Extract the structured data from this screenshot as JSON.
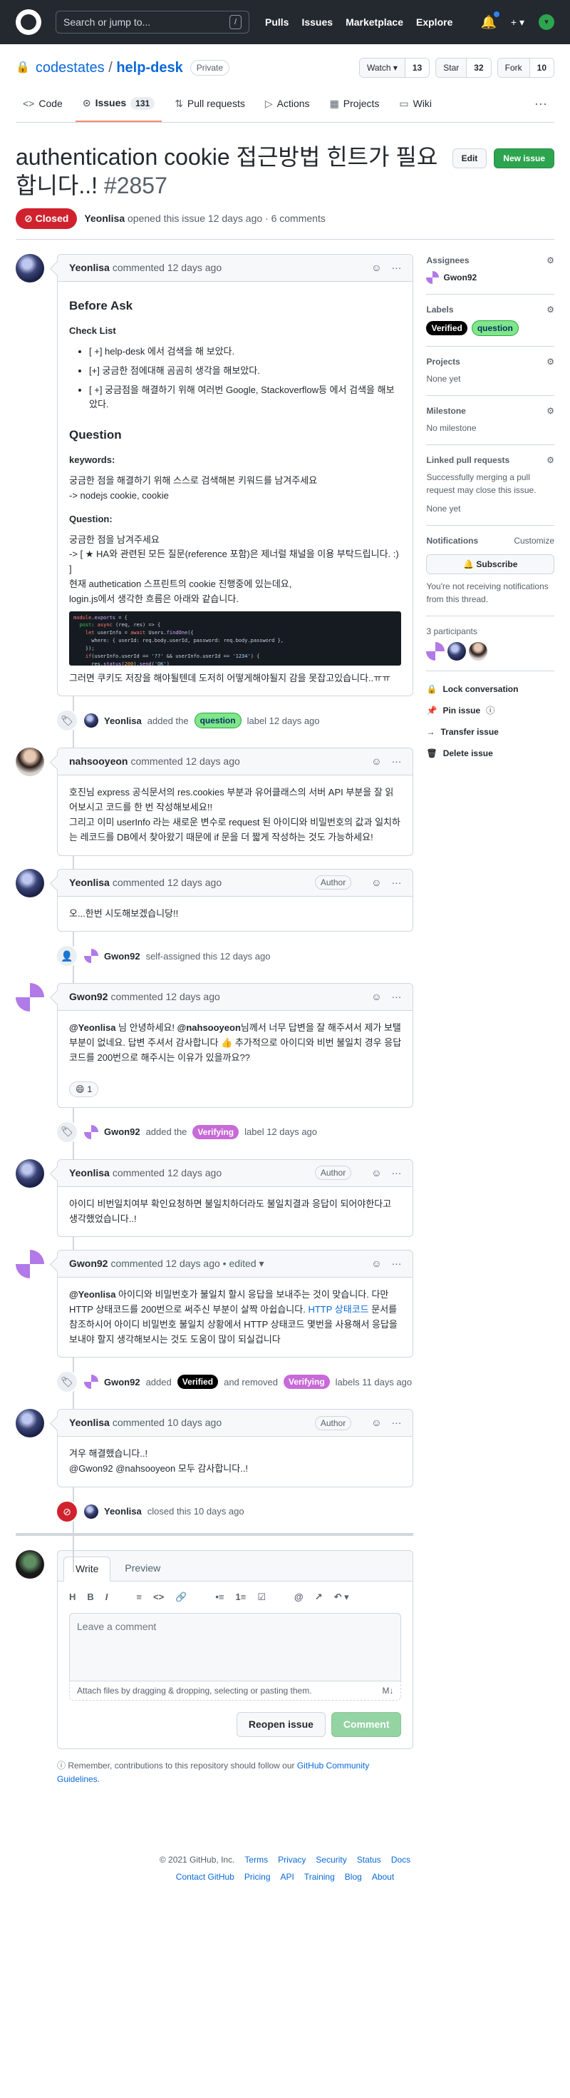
{
  "header": {
    "search_placeholder": "Search or jump to...",
    "slash_key": "/",
    "nav": [
      "Pulls",
      "Issues",
      "Marketplace",
      "Explore"
    ],
    "plus": "+ ▾"
  },
  "repo": {
    "owner": "codestates",
    "sep": " / ",
    "name": "help-desk",
    "visibility": "Private",
    "watch_label": "Watch ▾",
    "watch_count": "13",
    "star_label": "Star",
    "star_count": "32",
    "fork_label": "Fork",
    "fork_count": "10",
    "tabs": [
      {
        "label": "Code",
        "icon": "<>"
      },
      {
        "label": "Issues",
        "icon": "⊙",
        "count": "131"
      },
      {
        "label": "Pull requests",
        "icon": "⇅"
      },
      {
        "label": "Actions",
        "icon": "▷"
      },
      {
        "label": "Projects",
        "icon": "▦"
      },
      {
        "label": "Wiki",
        "icon": "▭"
      }
    ],
    "more": "···"
  },
  "issue": {
    "title": "authentication cookie 접근방법 힌트가 필요합니다..!",
    "number": "#2857",
    "edit_label": "Edit",
    "new_issue_label": "New issue",
    "state": "Closed",
    "author": "Yeonlisa",
    "meta": "opened this issue 12 days ago · 6 comments"
  },
  "comments": {
    "c1": {
      "author": "Yeonlisa",
      "time": "commented 12 days ago",
      "h_before": "Before Ask",
      "h_check": "Check List",
      "check": [
        "[ +] help-desk 에서 검색을 해 보았다.",
        "[+] 궁금한 점에대해 곰곰히 생각을 해보았다.",
        "[ +] 궁금점을 해결하기 위해 여러번 Google, Stackoverflow등 에서 검색을 해보았다."
      ],
      "h_question": "Question",
      "h_keywords": "keywords:",
      "kw1": "궁금한 점을 해결하기 위해 스스로 검색해본 키워드를 남겨주세요",
      "kw2": "-> nodejs cookie, cookie",
      "h_q": "Question:",
      "q1": "궁금한 점을 남겨주세요",
      "q2": "-> [ ★ HA와 관련된 모든 질문(reference 포함)은 제너럴 채널을 이용 부탁드립니다. :) ]",
      "q3": "현재 authetication 스프린트의 cookie 진행중에 있는데요,",
      "q4": "login.js에서 생각한 흐름은 아래와 같습니다.",
      "q5": "그러면 쿠키도 저장을 해야될텐데 도저히 어떻게해야될지 감을 못잡고있습니다..ㅠㅠ"
    },
    "ev1": {
      "who": "Yeonlisa",
      "a": "added the",
      "label": "question",
      "b": "label 12 days ago"
    },
    "c2": {
      "author": "nahsooyeon",
      "time": "commented 12 days ago",
      "p1": "호진님 express 공식문서의 res.cookies 부분과 유어클래스의 서버 API 부분을 잘 읽어보시고 코드를 한 번 작성해보세요!!",
      "p2": "그리고 이미 userInfo 라는 새로운 변수로 request 된 아이디와 비밀번호의 값과 일치하는 레코드를 DB에서 찾아왔기 때문에 if 문을 더 짧게 작성하는 것도 가능하세요!"
    },
    "c3": {
      "author": "Yeonlisa",
      "time": "commented 12 days ago",
      "badge": "Author",
      "p1": "오...한번 시도해보겠습니당!!"
    },
    "ev2": {
      "who": "Gwon92",
      "text": "self-assigned this 12 days ago"
    },
    "c4": {
      "author": "Gwon92",
      "time": "commented 12 days ago",
      "m1": "@Yeonlisa",
      "t1": " 님 안녕하세요! ",
      "m2": "@nahsooyeon",
      "t2": "님께서 너무 답변을 잘 해주셔서 제가 보탤 부분이 없네요. 답변 주셔서 감사합니다 👍 추가적으로 아이디와 비번 불일치 경우 응답코드를 200번으로 해주시는 이유가 있을까요??",
      "reaction": "😄",
      "reaction_count": "1"
    },
    "ev3": {
      "who": "Gwon92",
      "a": "added the",
      "label": "Verifying",
      "b": "label 12 days ago"
    },
    "c5": {
      "author": "Yeonlisa",
      "time": "commented 12 days ago",
      "badge": "Author",
      "p1": "아이디 비번일치여부 확인요청하면 불일치하더라도 불일치결과 응답이 되어야한다고 생각했었습니다..!"
    },
    "c6": {
      "author": "Gwon92",
      "time": "commented 12 days ago • edited ▾",
      "m1": "@Yeonlisa",
      "t1": " 아이디와 비밀번호가 불일치 할시 응답을 보내주는 것이 맞습니다. 다만 HTTP 상태코드를 200번으로 써주신 부분이 살짝 아쉽습니다. ",
      "link": "HTTP 상태코드",
      "t2": " 문서를 참조하시어 아이디 비밀번호 불일치 상황에서 HTTP 상태코드 몇번을 사용해서 응답을 보내야 할지 생각해보시는 것도 도움이 많이 되실겁니다"
    },
    "ev4": {
      "who": "Gwon92",
      "a": "added",
      "label1": "Verified",
      "b": "and removed",
      "label2": "Verifying",
      "c": "labels 11 days ago"
    },
    "c7": {
      "author": "Yeonlisa",
      "time": "commented 10 days ago",
      "badge": "Author",
      "p1": "겨우 해결했습니다..!",
      "p2": "@Gwon92 @nahsooyeon 모두 감사합니다..!"
    },
    "ev5": {
      "who": "Yeonlisa",
      "text": "closed this 10 days ago"
    }
  },
  "composer": {
    "tab_write": "Write",
    "tab_preview": "Preview",
    "tools": [
      "H",
      "B",
      "I",
      "≡",
      "<>",
      "🔗",
      "•≡",
      "1≡",
      "☑",
      "@",
      "↗",
      "↶ ▾"
    ],
    "placeholder": "Leave a comment",
    "attach": "Attach files by dragging & dropping, selecting or pasting them.",
    "md": "M↓",
    "reopen": "Reopen issue",
    "comment": "Comment",
    "remind_pre": "Remember, contributions to this repository should follow our ",
    "remind_link": "GitHub Community Guidelines",
    "remind_post": "."
  },
  "sidebar": {
    "assignees_title": "Assignees",
    "assignee": "Gwon92",
    "labels_title": "Labels",
    "label1": "Verified",
    "label2": "question",
    "projects_title": "Projects",
    "projects_val": "None yet",
    "milestone_title": "Milestone",
    "milestone_val": "No milestone",
    "linked_title": "Linked pull requests",
    "linked_desc": "Successfully merging a pull request may close this issue.",
    "linked_val": "None yet",
    "notif_title": "Notifications",
    "customize": "Customize",
    "subscribe": "🔔 Subscribe",
    "notif_desc": "You're not receiving notifications from this thread.",
    "participants_title": "3 participants",
    "lock": "Lock conversation",
    "pin": "Pin issue",
    "transfer": "Transfer issue",
    "delete": "Delete issue"
  },
  "footer": {
    "copyright": "© 2021 GitHub, Inc.",
    "row1": [
      "Terms",
      "Privacy",
      "Security",
      "Status",
      "Docs"
    ],
    "row2": [
      "Contact GitHub",
      "Pricing",
      "API",
      "Training",
      "Blog",
      "About"
    ]
  }
}
